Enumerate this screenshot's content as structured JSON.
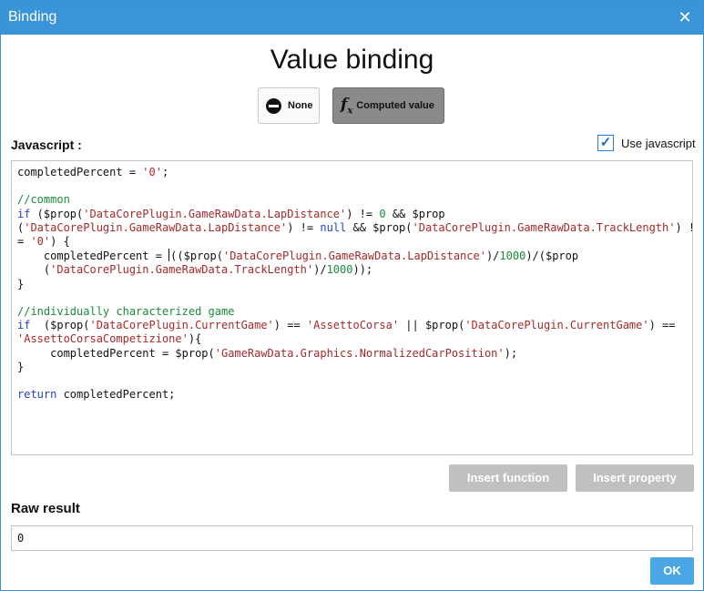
{
  "window": {
    "title": "Binding",
    "close_glyph": "✕"
  },
  "heading": "Value binding",
  "modes": {
    "none_label": "None",
    "computed_label": "Computed value",
    "selected": "Computed value"
  },
  "javascript": {
    "label": "Javascript :",
    "use_js_label": "Use javascript",
    "use_js_checked": true,
    "code_lines": [
      [
        [
          "completedPercent = ",
          ""
        ],
        [
          "'0'",
          "s"
        ],
        [
          ";",
          ""
        ]
      ],
      [],
      [
        [
          "//common",
          "c"
        ]
      ],
      [
        [
          "if",
          "k"
        ],
        [
          " ($prop(",
          ""
        ],
        [
          "'DataCorePlugin.GameRawData.LapDistance'",
          "s"
        ],
        [
          ") != ",
          ""
        ],
        [
          "0",
          "n"
        ],
        [
          " && $prop",
          ""
        ]
      ],
      [
        [
          "(",
          ""
        ],
        [
          "'DataCorePlugin.GameRawData.LapDistance'",
          "s"
        ],
        [
          ") != ",
          ""
        ],
        [
          "null",
          "k"
        ],
        [
          " && $prop(",
          ""
        ],
        [
          "'DataCorePlugin.GameRawData.TrackLength'",
          "s"
        ],
        [
          ") !",
          ""
        ]
      ],
      [
        [
          "= ",
          ""
        ],
        [
          "'0'",
          "s"
        ],
        [
          ") {",
          ""
        ]
      ],
      [
        [
          "    completedPercent = ",
          ""
        ],
        [
          "",
          "caret"
        ],
        [
          "(($prop(",
          ""
        ],
        [
          "'DataCorePlugin.GameRawData.LapDistance'",
          "s"
        ],
        [
          ")/",
          ""
        ],
        [
          "1000",
          "n"
        ],
        [
          ")/($prop",
          ""
        ]
      ],
      [
        [
          "    (",
          ""
        ],
        [
          "'DataCorePlugin.GameRawData.TrackLength'",
          "s"
        ],
        [
          ")/",
          ""
        ],
        [
          "1000",
          "n"
        ],
        [
          "));",
          ""
        ]
      ],
      [
        [
          "}",
          ""
        ]
      ],
      [],
      [
        [
          "//individually characterized game",
          "c"
        ]
      ],
      [
        [
          "if",
          "k"
        ],
        [
          "  ($prop(",
          ""
        ],
        [
          "'DataCorePlugin.CurrentGame'",
          "s"
        ],
        [
          ") == ",
          ""
        ],
        [
          "'AssettoCorsa'",
          "s"
        ],
        [
          " || $prop(",
          ""
        ],
        [
          "'DataCorePlugin.CurrentGame'",
          "s"
        ],
        [
          ") ==",
          ""
        ]
      ],
      [
        [
          "'AssettoCorsaCompetizione'",
          "s"
        ],
        [
          "){",
          ""
        ]
      ],
      [
        [
          "     completedPercent = $prop(",
          ""
        ],
        [
          "'GameRawData.Graphics.NormalizedCarPosition'",
          "s"
        ],
        [
          ");",
          ""
        ]
      ],
      [
        [
          "}",
          ""
        ]
      ],
      [],
      [
        [
          "return",
          "k"
        ],
        [
          " completedPercent;",
          ""
        ]
      ]
    ]
  },
  "buttons": {
    "insert_function": "Insert function",
    "insert_property": "Insert property",
    "ok": "OK"
  },
  "raw_result": {
    "label": "Raw result",
    "value": "0"
  },
  "colors": {
    "titlebar": "#3a95d8",
    "keyword": "#1f3fd0",
    "string": "#a52a2a",
    "number_comment": "#1a8a3a",
    "ok_button": "#4aa7e3"
  },
  "icons": {
    "none": "none-circle-icon",
    "computed": "fx-icon",
    "check": "checkmark-icon",
    "close": "close-icon"
  }
}
